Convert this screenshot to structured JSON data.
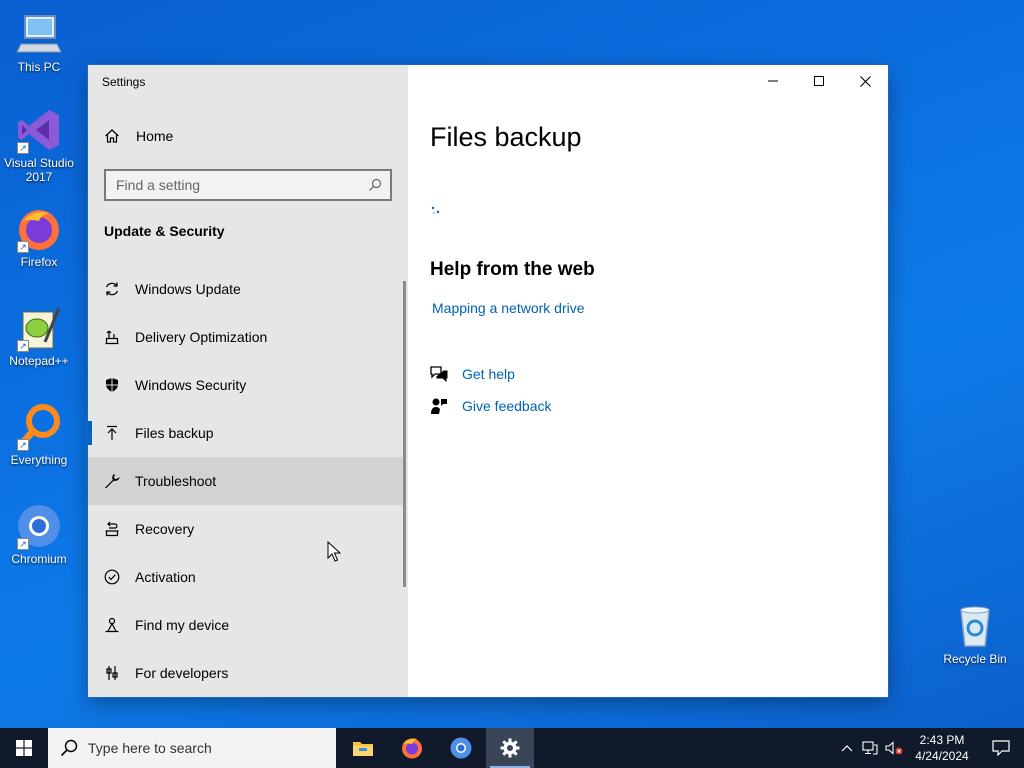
{
  "desktop": {
    "icons": [
      {
        "label": "This PC",
        "icon": "this-pc-icon"
      },
      {
        "label": "Visual Studio 2017",
        "icon": "visual-studio-icon"
      },
      {
        "label": "Firefox",
        "icon": "firefox-icon"
      },
      {
        "label": "Notepad++",
        "icon": "notepad-plus-plus-icon"
      },
      {
        "label": "Everything",
        "icon": "everything-search-icon"
      },
      {
        "label": "Chromium",
        "icon": "chromium-icon"
      },
      {
        "label": "Recycle Bin",
        "icon": "recycle-bin-icon"
      }
    ]
  },
  "window": {
    "title": "Settings",
    "controls": {
      "minimize": "minimize-icon",
      "maximize": "maximize-icon",
      "close": "close-icon"
    }
  },
  "sidebar": {
    "home_label": "Home",
    "search_placeholder": "Find a setting",
    "section_title": "Update & Security",
    "items": [
      {
        "label": "Windows Update",
        "icon": "sync-icon"
      },
      {
        "label": "Delivery Optimization",
        "icon": "delivery-optimization-icon"
      },
      {
        "label": "Windows Security",
        "icon": "shield-icon"
      },
      {
        "label": "Files backup",
        "icon": "upload-arrow-icon",
        "selected": true
      },
      {
        "label": "Troubleshoot",
        "icon": "wrench-icon",
        "hovered": true
      },
      {
        "label": "Recovery",
        "icon": "recovery-icon"
      },
      {
        "label": "Activation",
        "icon": "check-circle-icon"
      },
      {
        "label": "Find my device",
        "icon": "find-device-icon"
      },
      {
        "label": "For developers",
        "icon": "developer-tools-icon"
      }
    ]
  },
  "content": {
    "page_title": "Files backup",
    "help_title": "Help from the web",
    "help_links": [
      "Mapping a network drive"
    ],
    "actions": [
      {
        "label": "Get help",
        "icon": "get-help-icon"
      },
      {
        "label": "Give feedback",
        "icon": "feedback-icon"
      }
    ]
  },
  "taskbar": {
    "search_placeholder": "Type here to search",
    "apps": [
      "file-explorer-icon",
      "firefox-icon",
      "chromium-icon",
      "settings-gear-icon"
    ],
    "active_app": "settings-gear-icon",
    "time": "2:43 PM",
    "date": "4/24/2024"
  },
  "colors": {
    "accent": "#0067c0",
    "link": "#0063b1",
    "sidebar_bg": "#e6e6e6",
    "taskbar_bg": "#101a2b"
  }
}
